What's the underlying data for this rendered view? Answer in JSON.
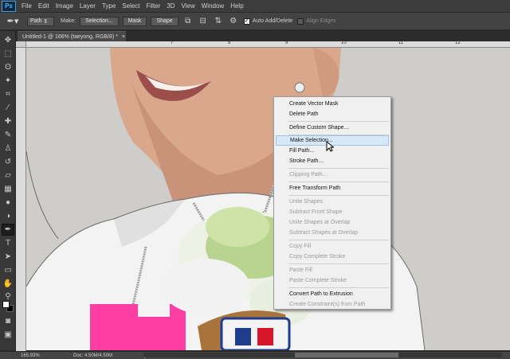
{
  "app": {
    "logo": "Ps"
  },
  "menubar": [
    "File",
    "Edit",
    "Image",
    "Layer",
    "Type",
    "Select",
    "Filter",
    "3D",
    "View",
    "Window",
    "Help"
  ],
  "options": {
    "mode_value": "Path",
    "make_label": "Make:",
    "selection_button": "Selection...",
    "mask_button": "Mask",
    "shape_button": "Shape",
    "auto_add_delete_label": "Auto Add/Delete",
    "auto_add_delete_checked": "✓",
    "align_edges_label": "Align Edges"
  },
  "document": {
    "tab_title": "Untitled-1 @ 166% (taeyong, RGB/8) *",
    "close": "×"
  },
  "rulers": {
    "h": [
      "7",
      "8",
      "9",
      "10",
      "11",
      "12"
    ]
  },
  "status": {
    "zoom": "165.93%",
    "doc": "Doc: 4.50M/4.50M",
    "arrow": "▶"
  },
  "context_menu": [
    {
      "label": "Create Vector Mask",
      "enabled": true
    },
    {
      "label": "Delete Path",
      "enabled": true
    },
    {
      "label": "Define Custom Shape...",
      "enabled": true
    },
    {
      "label": "Make Selection...",
      "enabled": true,
      "highlighted": true
    },
    {
      "label": "Fill Path...",
      "enabled": true
    },
    {
      "label": "Stroke Path...",
      "enabled": true
    },
    {
      "label": "Clipping Path...",
      "enabled": false
    },
    {
      "label": "Free Transform Path",
      "enabled": true
    },
    {
      "label": "Unite Shapes",
      "enabled": false
    },
    {
      "label": "Subtract Front Shape",
      "enabled": false
    },
    {
      "label": "Unite Shapes at Overlap",
      "enabled": false
    },
    {
      "label": "Subtract Shapes at Overlap",
      "enabled": false
    },
    {
      "label": "Copy Fill",
      "enabled": false
    },
    {
      "label": "Copy Complete Stroke",
      "enabled": false
    },
    {
      "label": "Paste Fill",
      "enabled": false
    },
    {
      "label": "Paste Complete Stroke",
      "enabled": false
    },
    {
      "label": "Convert Path to Extrusion",
      "enabled": true
    },
    {
      "label": "Create Constraint(s) from Path",
      "enabled": false
    }
  ],
  "colors": {
    "accent": "#4fb3f0",
    "menu_highlight": "#d8e8f8"
  }
}
